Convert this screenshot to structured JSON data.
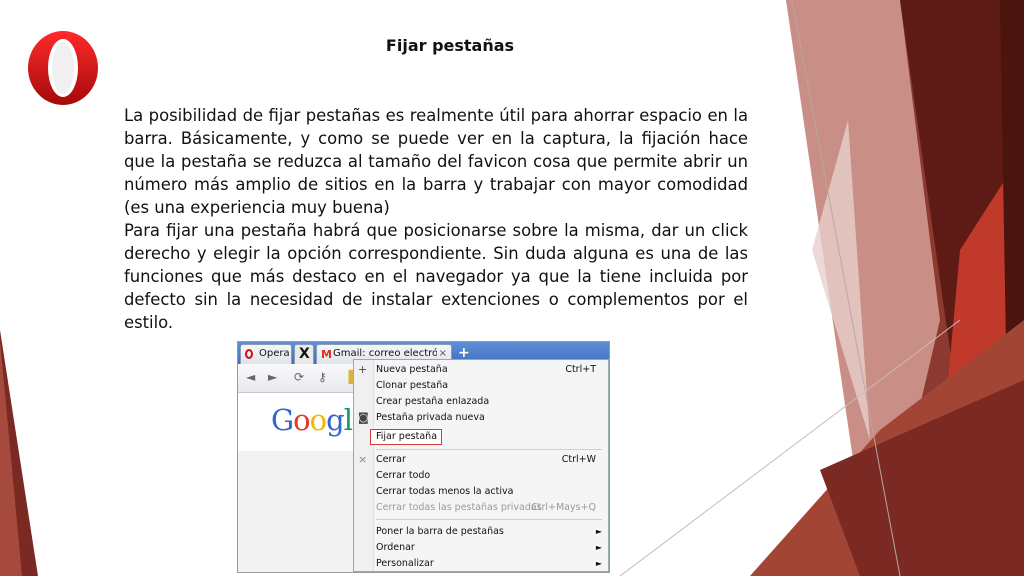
{
  "slide": {
    "title": "Fijar pestañas",
    "paragraph1": "La posibilidad de fijar pestañas es realmente útil para ahorrar espacio en la barra. Básicamente, y como se puede ver en la captura, la fijación hace que la pestaña se reduzca al tamaño del favicon cosa que permite abrir un número más amplio de sitios en la barra y trabajar con mayor comodidad (es una experiencia muy buena)",
    "paragraph2": "Para fijar una pestaña habrá que posicionarse sobre la misma, dar un click derecho y elegir la opción correspondiente. Sin duda alguna es una de las funciones que más destaco en el navegador ya que la tiene incluida por defecto sin la necesidad de instalar extenciones o complementos por el estilo.",
    "logo_icon": "opera-logo-icon"
  },
  "browser": {
    "tabs": [
      {
        "label": "Opera",
        "icon": "opera-icon"
      },
      {
        "label": "X",
        "icon": "pinned-tab-icon"
      },
      {
        "label": "Gmail: correo electróni...",
        "icon": "gmail-icon",
        "close": "×"
      }
    ],
    "new_tab": "+",
    "google_letters": [
      "G",
      "o",
      "o",
      "g",
      "l"
    ],
    "google_colors": [
      "#3366cc",
      "#dd3b2b",
      "#f4b400",
      "#3366cc",
      "#0f9d58"
    ]
  },
  "menu": {
    "items": [
      {
        "label": "Nueva pestaña",
        "shortcut": "Ctrl+T",
        "icon": "+"
      },
      {
        "label": "Clonar pestaña",
        "shortcut": ""
      },
      {
        "label": "Crear pestaña enlazada",
        "shortcut": ""
      },
      {
        "label": "Pestaña privada nueva",
        "shortcut": "",
        "icon": "◙"
      },
      {
        "label": "Fijar pestaña",
        "shortcut": ""
      },
      {
        "label": "Cerrar",
        "shortcut": "Ctrl+W",
        "icon": "×"
      },
      {
        "label": "Cerrar todo",
        "shortcut": ""
      },
      {
        "label": "Cerrar todas menos la activa",
        "shortcut": ""
      },
      {
        "label": "Cerrar todas las pestañas privadas",
        "shortcut": "Ctrl+Mays+Q",
        "disabled": true
      },
      {
        "label": "Poner la barra de pestañas",
        "shortcut": "",
        "submenu": "►"
      },
      {
        "label": "Ordenar",
        "shortcut": "",
        "submenu": "►"
      },
      {
        "label": "Personalizar",
        "shortcut": "",
        "submenu": "►"
      }
    ]
  },
  "colors": {
    "accent_dark": "#6b1f17",
    "accent_red": "#c0392b",
    "accent_light": "#c98e85"
  }
}
